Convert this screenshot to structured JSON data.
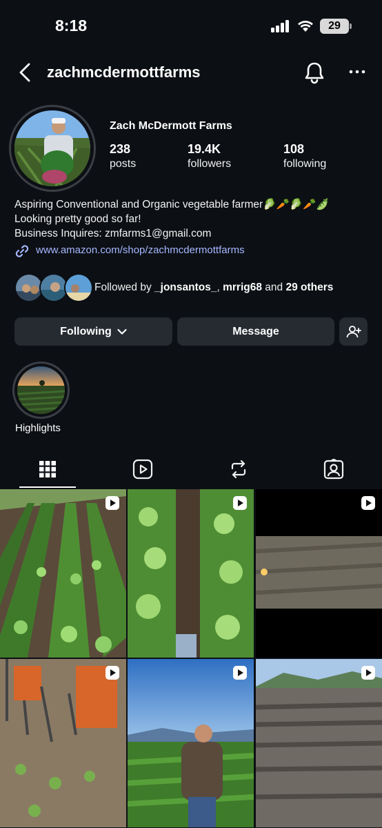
{
  "status_bar": {
    "time": "8:18",
    "battery": "29"
  },
  "header": {
    "username": "zachmcdermottfarms"
  },
  "profile": {
    "display_name": "Zach McDermott Farms",
    "stats": [
      {
        "count": "238",
        "label": "posts"
      },
      {
        "count": "19.4K",
        "label": "followers"
      },
      {
        "count": "108",
        "label": "following"
      }
    ],
    "bio": [
      "Aspiring Conventional and Organic vegetable farmer🥬🥕🥬🥕🫛",
      "Looking pretty good so far!",
      "Business Inquires: zmfarms1@gmail.com"
    ],
    "link": "www.amazon.com/shop/zachmcdermottfarms",
    "followed_by": {
      "prefix": "Followed by ",
      "user1": "_jonsantos_",
      "separator": ", ",
      "user2": "mrrig68",
      "conjunction": " and ",
      "others": "29 others"
    }
  },
  "actions": {
    "following_label": "Following",
    "message_label": "Message"
  },
  "highlights": [
    {
      "label": "Highlights"
    }
  ],
  "tabs": [
    {
      "icon": "grid-icon",
      "active": true
    },
    {
      "icon": "reels-icon",
      "active": false
    },
    {
      "icon": "repost-icon",
      "active": false
    },
    {
      "icon": "tagged-icon",
      "active": false
    }
  ],
  "colors": {
    "background": "#0c0f14",
    "button": "#262a31",
    "link": "#a5b8ff"
  }
}
